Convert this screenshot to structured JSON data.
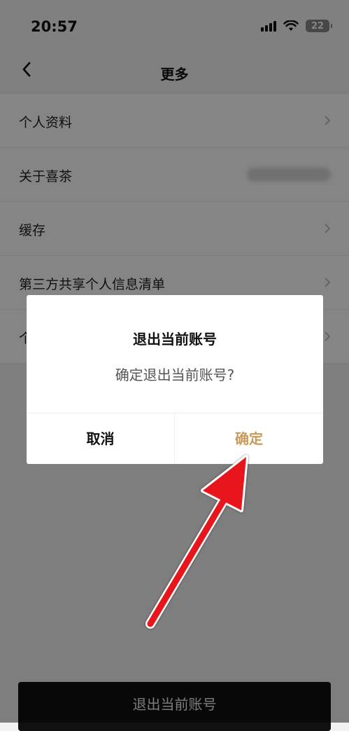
{
  "status_bar": {
    "time": "20:57",
    "battery": "22"
  },
  "nav": {
    "title": "更多"
  },
  "menu": [
    {
      "label": "个人资料",
      "has_chevron": true
    },
    {
      "label": "关于喜茶",
      "has_chevron": false
    },
    {
      "label": "缓存",
      "has_chevron": true
    },
    {
      "label": "第三方共享个人信息清单",
      "has_chevron": true
    },
    {
      "label": "个",
      "has_chevron": true
    }
  ],
  "bottom_button": {
    "label": "退出当前账号"
  },
  "dialog": {
    "title": "退出当前账号",
    "message": "确定退出当前账号?",
    "cancel_label": "取消",
    "confirm_label": "确定"
  },
  "colors": {
    "confirm": "#c89a5b",
    "arrow": "#e8131b"
  }
}
